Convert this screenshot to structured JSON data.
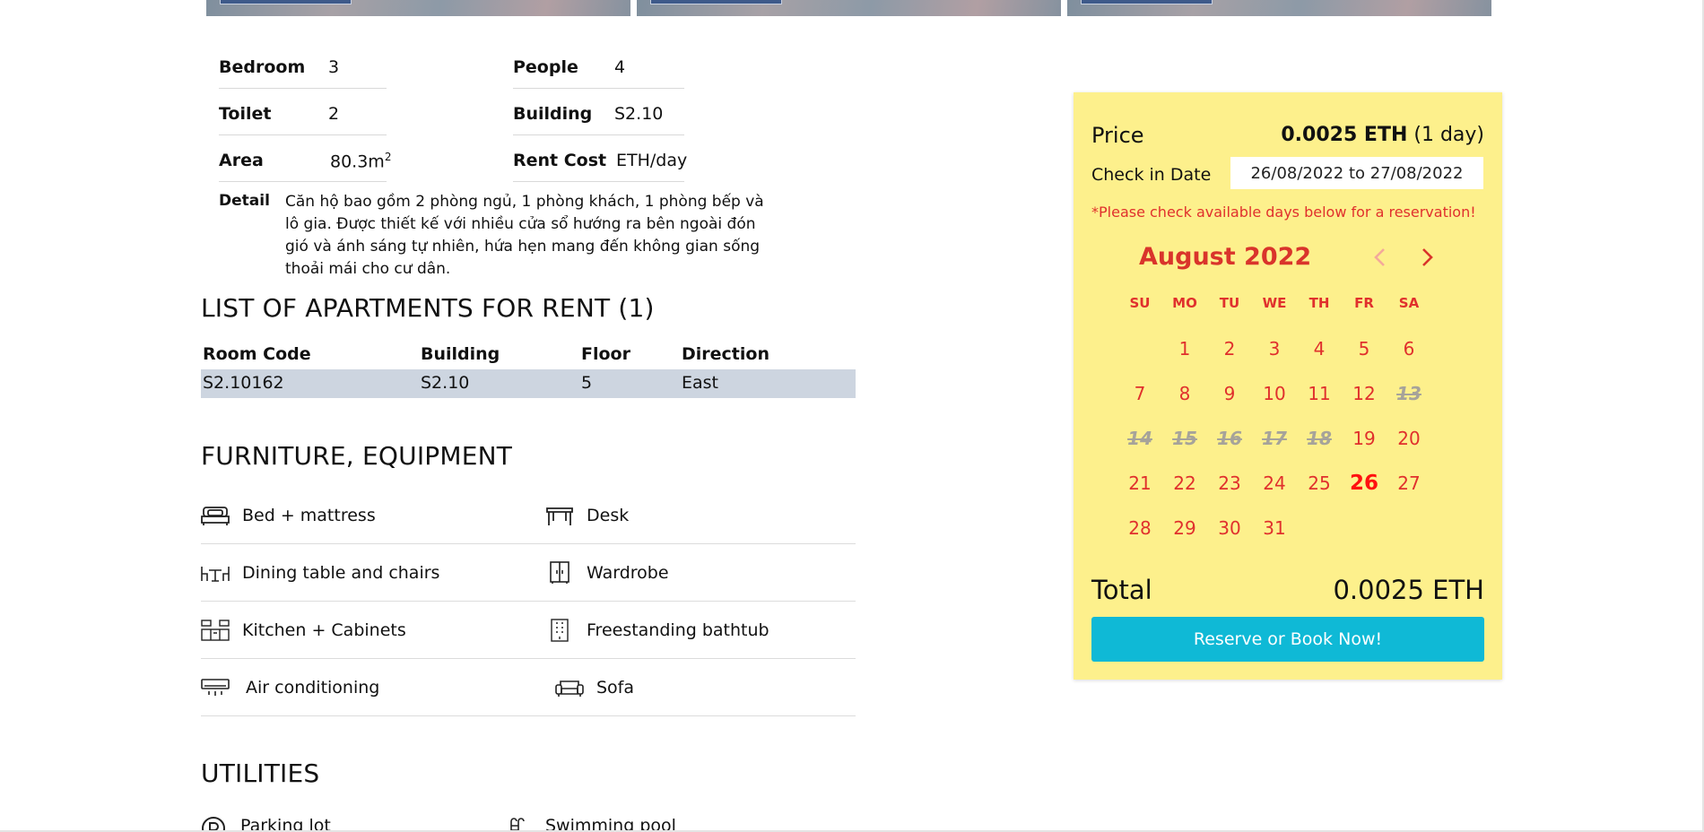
{
  "specs_left": [
    {
      "label": "Bedroom",
      "value": "3"
    },
    {
      "label": "Toilet",
      "value": "2"
    },
    {
      "label": "Area",
      "value": "80.3m",
      "sup": "2"
    }
  ],
  "specs_right": [
    {
      "label": "People",
      "value": "4"
    },
    {
      "label": "Building",
      "value": "S2.10"
    },
    {
      "label": "Rent Cost",
      "value": "ETH/day"
    }
  ],
  "detail": {
    "label": "Detail",
    "text": "Căn hộ bao gồm 2 phòng ngủ, 1 phòng khách, 1 phòng bếp và lô gia. Được thiết kế với nhiều cửa sổ hướng ra bên ngoài đón gió và ánh sáng tự nhiên, hứa hẹn mang đến không gian sống thoải mái cho cư dân."
  },
  "rent_list": {
    "title": "LIST OF APARTMENTS FOR RENT (1)",
    "headers": [
      "Room Code",
      "Building",
      "Floor",
      "Direction"
    ],
    "rows": [
      [
        "S2.10162",
        "S2.10",
        "5",
        "East"
      ]
    ]
  },
  "furniture": {
    "title": "FURNITURE, EQUIPMENT",
    "items": [
      {
        "label": "Bed + mattress",
        "icon": "bed-icon"
      },
      {
        "label": "Desk",
        "icon": "desk-icon"
      },
      {
        "label": "Dining table and chairs",
        "icon": "dining-table-icon"
      },
      {
        "label": "Wardrobe",
        "icon": "wardrobe-icon"
      },
      {
        "label": "Kitchen + Cabinets",
        "icon": "kitchen-icon"
      },
      {
        "label": "Freestanding bathtub",
        "icon": "bathtub-icon"
      },
      {
        "label": "Air conditioning",
        "icon": "air-conditioner-icon"
      },
      {
        "label": "Sofa",
        "icon": "sofa-icon"
      }
    ]
  },
  "utilities": {
    "title": "UTILITIES",
    "items": [
      {
        "label": "Parking lot",
        "icon": "parking-icon"
      },
      {
        "label": "Swimming pool",
        "icon": "pool-icon"
      }
    ]
  },
  "booking": {
    "price_label": "Price",
    "price_value": "0.0025 ETH",
    "price_unit": "(1 day)",
    "checkin_label": "Check in Date",
    "checkin_value": "26/08/2022 to 27/08/2022",
    "warning": "*Please check available days below for a reservation!",
    "calendar": {
      "month": "August 2022",
      "weekdays": [
        "SU",
        "MO",
        "TU",
        "WE",
        "TH",
        "FR",
        "SA"
      ],
      "first_weekday_index": 1,
      "days_in_month": 31,
      "unavailable_days": [
        13,
        14,
        15,
        16,
        17,
        18
      ],
      "selected_day": 26
    },
    "total_label": "Total",
    "total_value": "0.0025 ETH",
    "reserve_button": "Reserve or Book Now!"
  },
  "colors": {
    "panel_bg": "#fdf08c",
    "accent_red": "#e0302d",
    "button": "#0fb9d6",
    "row_highlight": "#cdd5e0"
  }
}
